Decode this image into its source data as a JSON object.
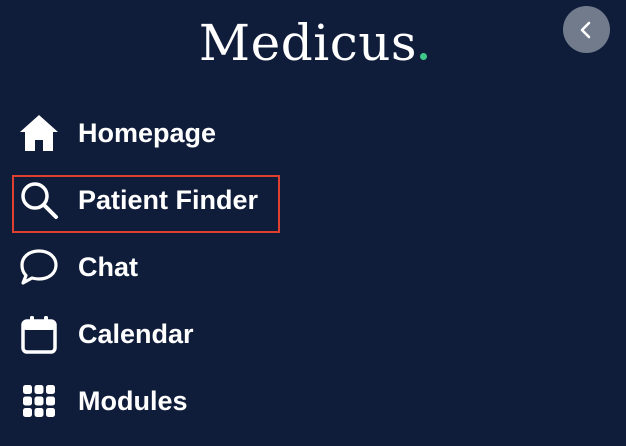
{
  "brand": {
    "name": "Medicus",
    "dot_color": "#3ec98a"
  },
  "colors": {
    "background": "#0f1c3a",
    "highlight": "#e0402f",
    "collapse_button": "#717b8c"
  },
  "collapse_button": {
    "icon": "chevron-left-icon"
  },
  "nav": {
    "items": [
      {
        "label": "Homepage",
        "icon": "home-icon"
      },
      {
        "label": "Patient Finder",
        "icon": "search-icon",
        "highlighted": true
      },
      {
        "label": "Chat",
        "icon": "chat-bubble-icon"
      },
      {
        "label": "Calendar",
        "icon": "calendar-icon"
      },
      {
        "label": "Modules",
        "icon": "grid-icon"
      }
    ]
  }
}
